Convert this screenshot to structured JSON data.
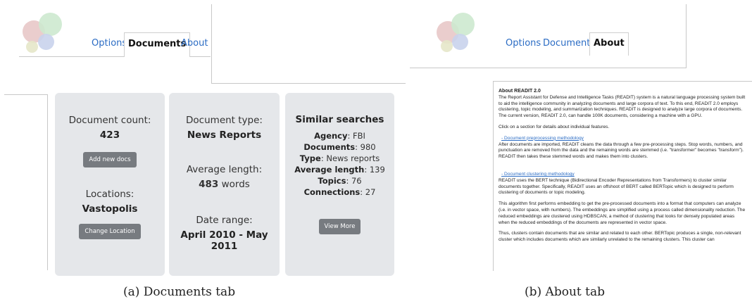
{
  "panel_a": {
    "tabs": [
      {
        "label": "Options",
        "active": false
      },
      {
        "label": "Documents",
        "active": true
      },
      {
        "label": "About",
        "active": false
      }
    ],
    "card1": {
      "doc_count_label": "Document count:",
      "doc_count_value": "423",
      "add_button": "Add new docs",
      "locations_label": "Locations:",
      "locations_value": "Vastopolis",
      "change_button": "Change Location"
    },
    "card2": {
      "doc_type_label": "Document type:",
      "doc_type_value": "News Reports",
      "avg_len_label": "Average length:",
      "avg_len_number": "483",
      "avg_len_unit": "words",
      "date_label": "Date range:",
      "date_value": "April 2010 - May 2011"
    },
    "card3": {
      "title": "Similar searches",
      "rows": [
        {
          "key": "Agency",
          "value": "FBI"
        },
        {
          "key": "Documents",
          "value": "980"
        },
        {
          "key": "Type",
          "value": "News reports"
        },
        {
          "key": "Average length",
          "value": "139"
        },
        {
          "key": "Topics",
          "value": "76"
        },
        {
          "key": "Connections",
          "value": "27"
        }
      ],
      "view_more_button": "View More"
    },
    "caption": "(a) Documents tab"
  },
  "panel_b": {
    "tabs": [
      {
        "label": "Options",
        "active": false
      },
      {
        "label": "Documents",
        "active": false
      },
      {
        "label": "About",
        "active": true
      }
    ],
    "about": {
      "heading": "About READIT 2.0",
      "intro": "The Report Assistant for Defense and Intelligence Tasks (READIT) system is a natural language processing system built to aid the intelligence community in analyzing documents and large corpora of text. To this end, READIT 2.0 employs clustering, topic modeling, and summarization techniques. READIT is designed to analyze large corpora of documents. The current version, READIT 2.0, can handle 100K documents, considering a machine with a GPU.",
      "click_note": "Click on a section for details about individual features.",
      "section1_link": "- Document preprocessing methodology",
      "section1_text": "After documents are imported, READIT cleans the data through a few pre-processing steps. Stop words, numbers, and punctuation are removed from the data and the remaining words are stemmed (i.e. \"transformer\" becomes \"transform\"). READIT then takes these stemmed words and makes them into clusters.",
      "section2_link": "- Document clustering methodology",
      "section2_text": "READIT uses the BERT technique (Bidirectional Encoder Representations from Transformers) to cluster similar documents together. Specifically, READIT uses an offshoot of BERT called BERTopic which is designed to perform clustering of documents or topic modeling.",
      "para3": "This algorithm first performs embedding to get the pre-processed documents into a format that computers can analyze (i.e. in vector space, with numbers). The embeddings are simplified using a process called dimensionality reduction. The reduced embeddings are clustered using HDBSCAN, a method of clustering that looks for densely populated areas when the reduced embeddings of the documents are represented in vector space.",
      "para4": "Thus, clusters contain documents that are similar and related to each other. BERTopic produces a single, non-relevant cluster which includes documents which are similarly unrelated to the remaining clusters. This cluster can"
    },
    "caption": "(b) About tab"
  },
  "colors": {
    "logo_red": "#e8c8c8",
    "logo_green": "#cde9cf",
    "logo_blue": "#c9d3ec",
    "logo_yellow": "#e5e7c9",
    "card_bg": "#e5e7ea",
    "button_bg": "#777b80",
    "tab_link": "#2b6cc4"
  }
}
